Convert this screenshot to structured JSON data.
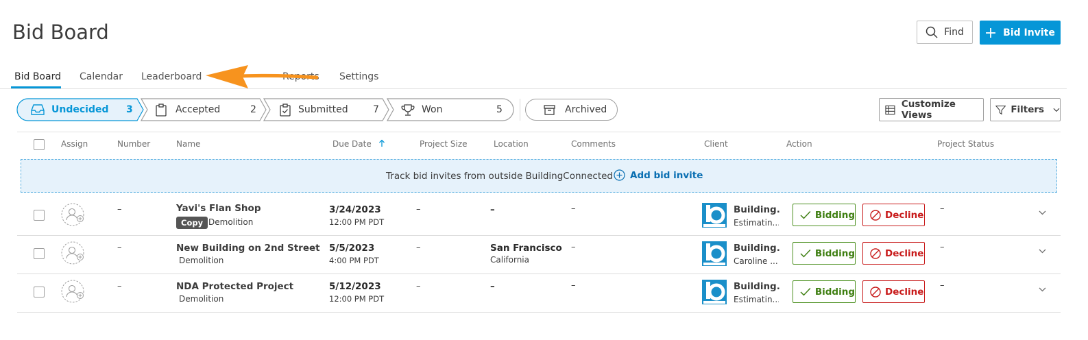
{
  "header": {
    "title": "Bid Board",
    "find_label": "Find",
    "bid_invite_label": "Bid Invite"
  },
  "tabs": [
    {
      "label": "Bid Board",
      "active": true
    },
    {
      "label": "Calendar"
    },
    {
      "label": "Leaderboard"
    },
    {
      "label": "Reports"
    },
    {
      "label": "Settings"
    }
  ],
  "stages": [
    {
      "label": "Undecided",
      "count": "3",
      "icon": "inbox-tray-icon",
      "active": true
    },
    {
      "label": "Accepted",
      "count": "2",
      "icon": "clipboard-icon"
    },
    {
      "label": "Submitted",
      "count": "7",
      "icon": "clipboard-check-icon"
    },
    {
      "label": "Won",
      "count": "5",
      "icon": "trophy-icon"
    }
  ],
  "archived_label": "Archived",
  "toolbar": {
    "customize_label": "Customize Views",
    "filters_label": "Filters"
  },
  "columns": {
    "assign": "Assign",
    "number": "Number",
    "name": "Name",
    "due_date": "Due Date",
    "project_size": "Project Size",
    "location": "Location",
    "comments": "Comments",
    "client": "Client",
    "action": "Action",
    "project_status": "Project Status"
  },
  "banner": {
    "text": "Track bid invites from outside BuildingConnected",
    "link": "Add bid invite"
  },
  "actions": {
    "bidding": "Bidding",
    "decline": "Decline"
  },
  "rows": [
    {
      "number": "–",
      "name": "Yavi's Flan Shop",
      "badge": "Copy",
      "trade": "Demolition",
      "due_date": "3/24/2023",
      "due_time": "12:00 PM PDT",
      "project_size": "–",
      "location": "–",
      "location_sub": "",
      "comments": "–",
      "client_name": "Building...",
      "client_sub": "Estimatin...",
      "status": "–"
    },
    {
      "number": "–",
      "name": "New Building on 2nd Street",
      "badge": "",
      "trade": "Demolition",
      "due_date": "5/5/2023",
      "due_time": "4:00 PM PDT",
      "project_size": "–",
      "location": "San Francisco",
      "location_sub": "California",
      "comments": "–",
      "client_name": "Building...",
      "client_sub": "Caroline ...",
      "status": "–"
    },
    {
      "number": "–",
      "name": "NDA Protected Project",
      "badge": "",
      "trade": "Demolition",
      "due_date": "5/12/2023",
      "due_time": "12:00 PM PDT",
      "project_size": "–",
      "location": "–",
      "location_sub": "",
      "comments": "–",
      "client_name": "Building...",
      "client_sub": "Estimatin...",
      "status": "–"
    }
  ],
  "colors": {
    "accent": "#0696d7",
    "bidding": "#3f7f12",
    "decline": "#c81a1a",
    "annotation_arrow": "#f7931e"
  }
}
